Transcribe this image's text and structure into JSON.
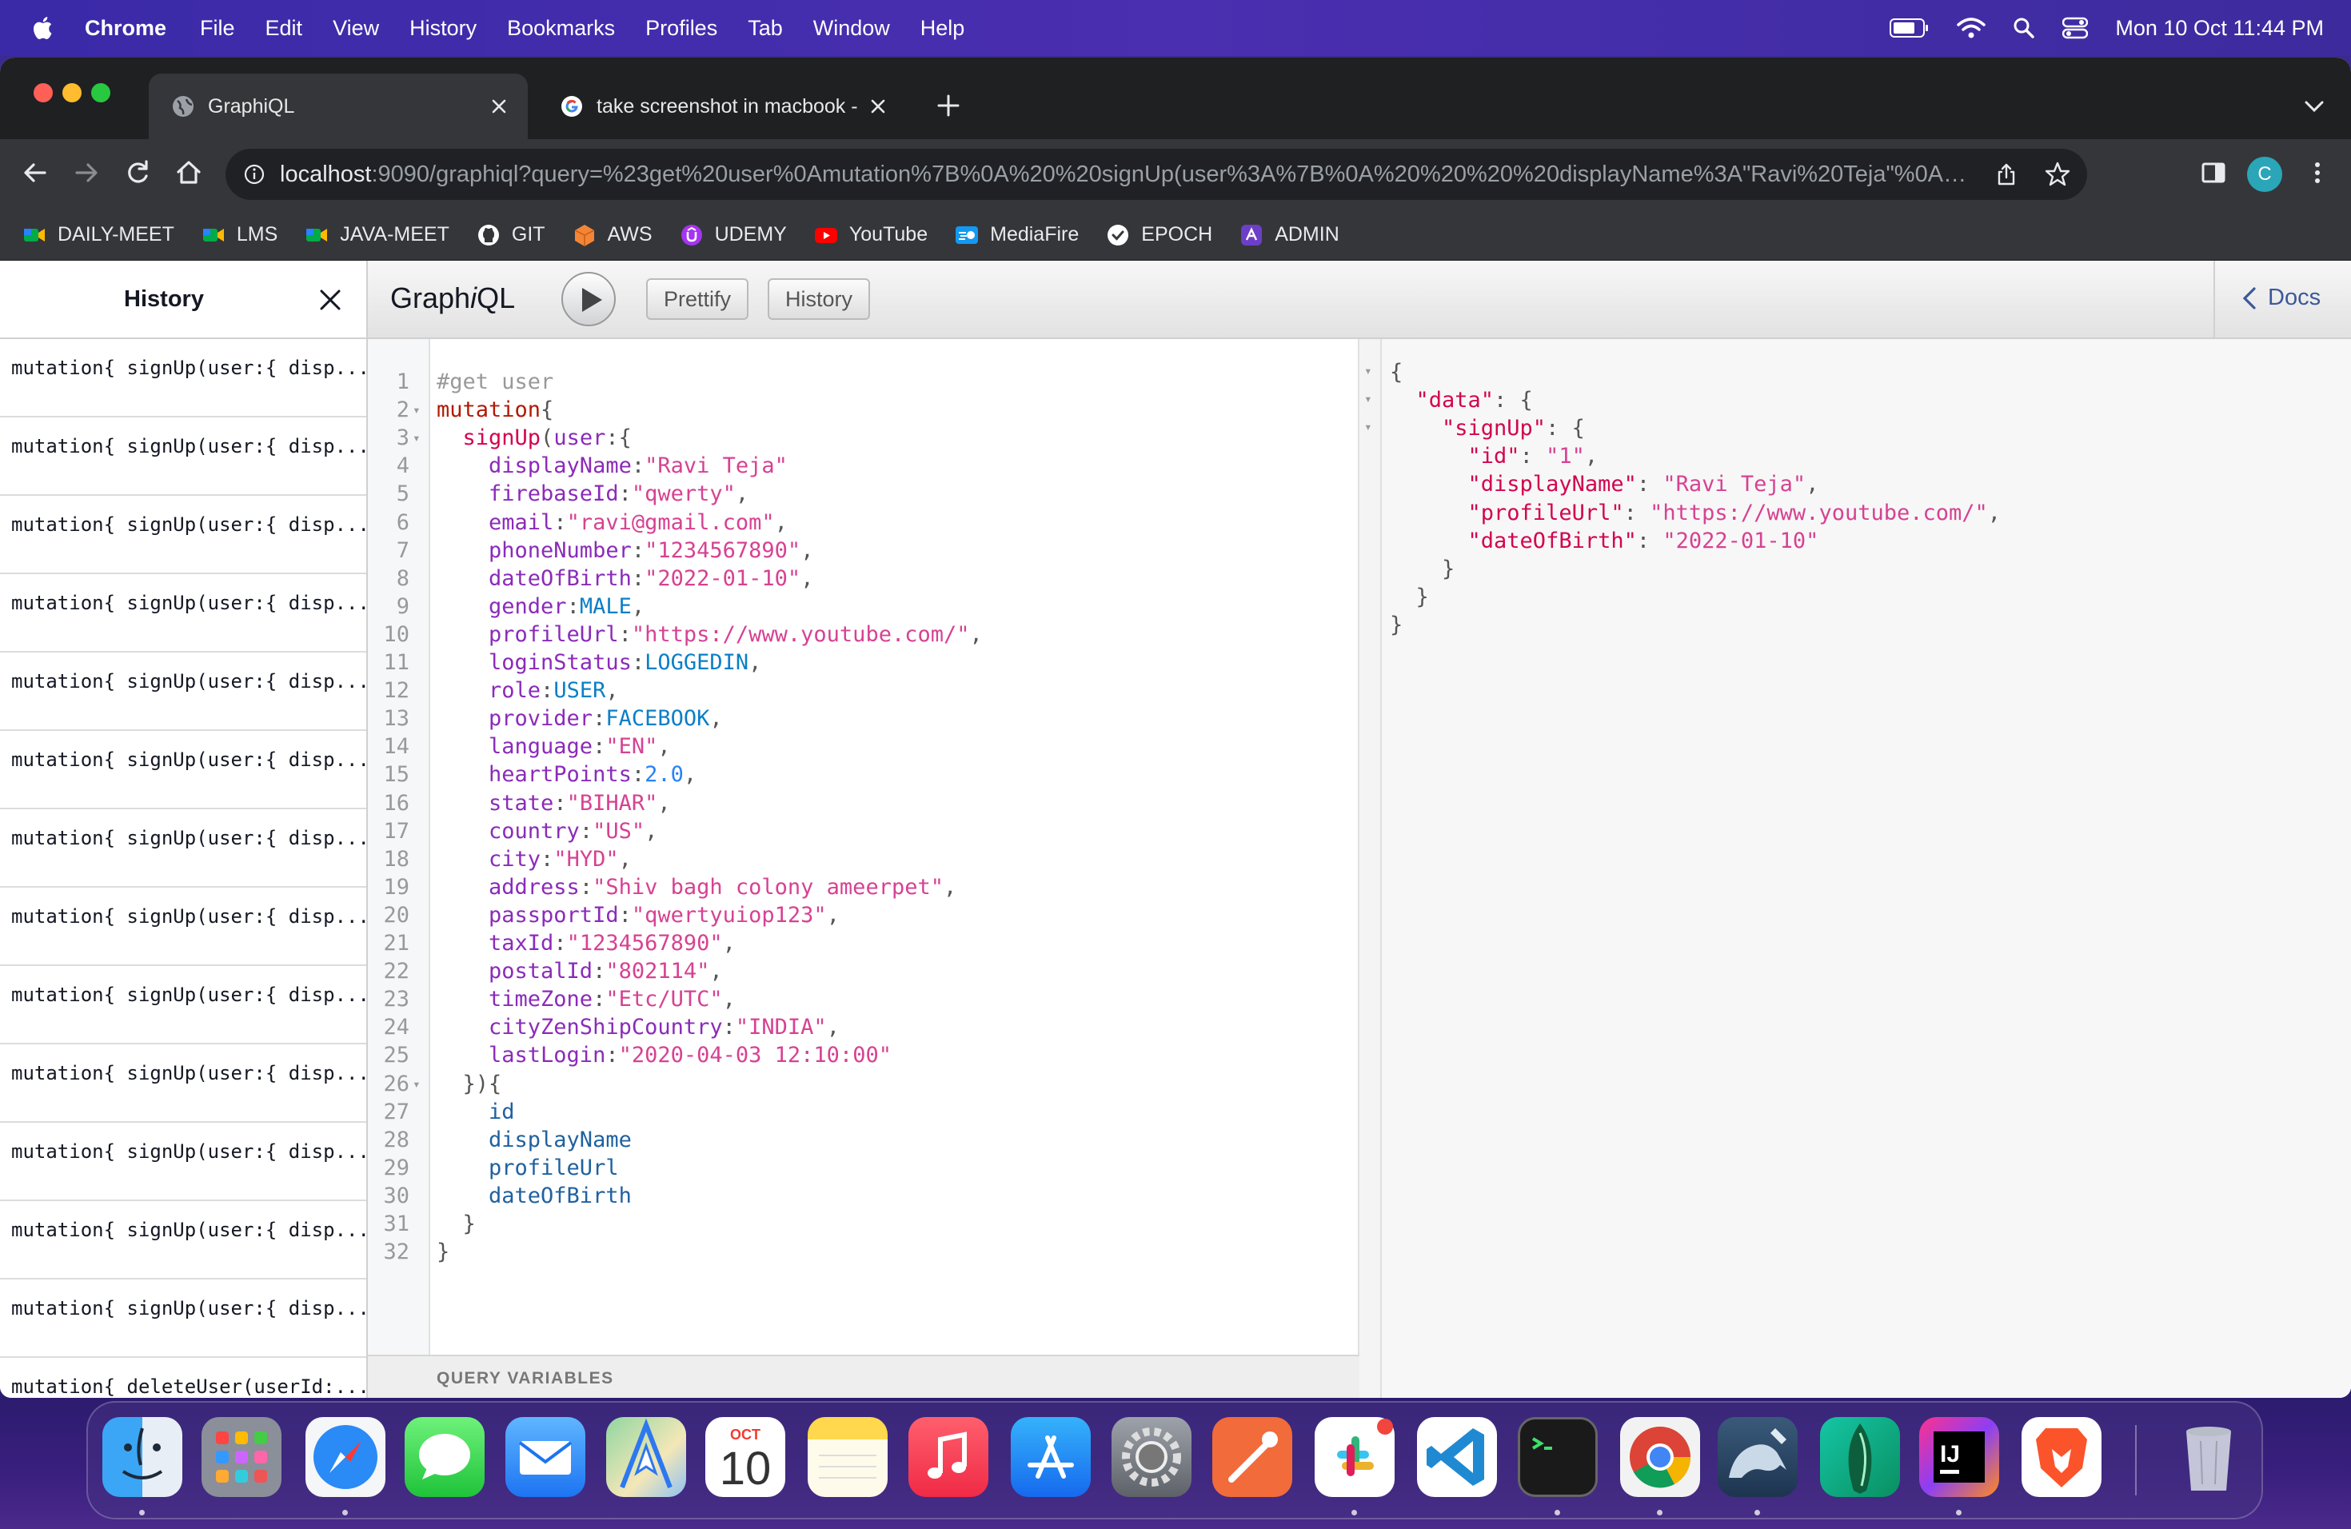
{
  "menubar": {
    "app": "Chrome",
    "menus": [
      "File",
      "Edit",
      "View",
      "History",
      "Bookmarks",
      "Profiles",
      "Tab",
      "Window",
      "Help"
    ],
    "clock": "Mon 10 Oct  11:44 PM"
  },
  "browser": {
    "tabs": [
      {
        "title": "GraphiQL",
        "active": true
      },
      {
        "title": "take screenshot in macbook - ",
        "active": false
      }
    ],
    "url_host": "localhost",
    "url_rest": ":9090/graphiql?query=%23get%20user%0Amutation%7B%0A%20%20signUp(user%3A%7B%0A%20%20%20%20displayName%3A\"Ravi%20Teja\"%0A%20...",
    "profile_initial": "C",
    "bookmarks": [
      "DAILY-MEET",
      "LMS",
      "JAVA-MEET",
      "GIT",
      "AWS",
      "UDEMY",
      "YouTube",
      "MediaFire",
      "EPOCH",
      "ADMIN"
    ]
  },
  "graphiql": {
    "title_prefix": "Graph",
    "title_italic": "i",
    "title_suffix": "QL",
    "prettify_label": "Prettify",
    "history_label": "History",
    "docs_label": "Docs",
    "query_variables_label": "QUERY VARIABLES",
    "history_panel": {
      "title": "History",
      "items": [
        "mutation{ signUp(user:{ disp...",
        "mutation{ signUp(user:{ disp...",
        "mutation{ signUp(user:{ disp...",
        "mutation{ signUp(user:{ disp...",
        "mutation{ signUp(user:{ disp...",
        "mutation{ signUp(user:{ disp...",
        "mutation{ signUp(user:{ disp...",
        "mutation{ signUp(user:{ disp...",
        "mutation{ signUp(user:{ disp...",
        "mutation{ signUp(user:{ disp...",
        "mutation{ signUp(user:{ disp...",
        "mutation{ signUp(user:{ disp...",
        "mutation{ signUp(user:{ disp...",
        "mutation{ deleteUser(userId:..."
      ]
    },
    "query_lines": [
      {
        "n": "1",
        "fold": "",
        "tokens": [
          [
            "c-comment",
            "#get user"
          ]
        ]
      },
      {
        "n": "2",
        "fold": "▾",
        "tokens": [
          [
            "c-keyword",
            "mutation"
          ],
          [
            "c-punc",
            "{"
          ]
        ]
      },
      {
        "n": "3",
        "fold": "▾",
        "tokens": [
          [
            "c-def",
            "  signUp"
          ],
          [
            "c-punc",
            "("
          ],
          [
            "c-attr",
            "user"
          ],
          [
            "c-punc",
            ":{"
          ]
        ]
      },
      {
        "n": "4",
        "fold": "",
        "tokens": [
          [
            "c-attr",
            "    displayName"
          ],
          [
            "c-punc",
            ":"
          ],
          [
            "c-string",
            "\"Ravi Teja\""
          ]
        ]
      },
      {
        "n": "5",
        "fold": "",
        "tokens": [
          [
            "c-attr",
            "    firebaseId"
          ],
          [
            "c-punc",
            ":"
          ],
          [
            "c-string",
            "\"qwerty\""
          ],
          [
            "c-punc",
            ","
          ]
        ]
      },
      {
        "n": "6",
        "fold": "",
        "tokens": [
          [
            "c-attr",
            "    email"
          ],
          [
            "c-punc",
            ":"
          ],
          [
            "c-string",
            "\"ravi@gmail.com\""
          ],
          [
            "c-punc",
            ","
          ]
        ]
      },
      {
        "n": "7",
        "fold": "",
        "tokens": [
          [
            "c-attr",
            "    phoneNumber"
          ],
          [
            "c-punc",
            ":"
          ],
          [
            "c-string",
            "\"1234567890\""
          ],
          [
            "c-punc",
            ","
          ]
        ]
      },
      {
        "n": "8",
        "fold": "",
        "tokens": [
          [
            "c-attr",
            "    dateOfBirth"
          ],
          [
            "c-punc",
            ":"
          ],
          [
            "c-string",
            "\"2022-01-10\""
          ],
          [
            "c-punc",
            ","
          ]
        ]
      },
      {
        "n": "9",
        "fold": "",
        "tokens": [
          [
            "c-attr",
            "    gender"
          ],
          [
            "c-punc",
            ":"
          ],
          [
            "c-enum",
            "MALE"
          ],
          [
            "c-punc",
            ","
          ]
        ]
      },
      {
        "n": "10",
        "fold": "",
        "tokens": [
          [
            "c-attr",
            "    profileUrl"
          ],
          [
            "c-punc",
            ":"
          ],
          [
            "c-string",
            "\"https://www.youtube.com/\""
          ],
          [
            "c-punc",
            ","
          ]
        ]
      },
      {
        "n": "11",
        "fold": "",
        "tokens": [
          [
            "c-attr",
            "    loginStatus"
          ],
          [
            "c-punc",
            ":"
          ],
          [
            "c-enum",
            "LOGGEDIN"
          ],
          [
            "c-punc",
            ","
          ]
        ]
      },
      {
        "n": "12",
        "fold": "",
        "tokens": [
          [
            "c-attr",
            "    role"
          ],
          [
            "c-punc",
            ":"
          ],
          [
            "c-enum",
            "USER"
          ],
          [
            "c-punc",
            ","
          ]
        ]
      },
      {
        "n": "13",
        "fold": "",
        "tokens": [
          [
            "c-attr",
            "    provider"
          ],
          [
            "c-punc",
            ":"
          ],
          [
            "c-enum",
            "FACEBOOK"
          ],
          [
            "c-punc",
            ","
          ]
        ]
      },
      {
        "n": "14",
        "fold": "",
        "tokens": [
          [
            "c-attr",
            "    language"
          ],
          [
            "c-punc",
            ":"
          ],
          [
            "c-string",
            "\"EN\""
          ],
          [
            "c-punc",
            ","
          ]
        ]
      },
      {
        "n": "15",
        "fold": "",
        "tokens": [
          [
            "c-attr",
            "    heartPoints"
          ],
          [
            "c-punc",
            ":"
          ],
          [
            "c-num",
            "2.0"
          ],
          [
            "c-punc",
            ","
          ]
        ]
      },
      {
        "n": "16",
        "fold": "",
        "tokens": [
          [
            "c-attr",
            "    state"
          ],
          [
            "c-punc",
            ":"
          ],
          [
            "c-string",
            "\"BIHAR\""
          ],
          [
            "c-punc",
            ","
          ]
        ]
      },
      {
        "n": "17",
        "fold": "",
        "tokens": [
          [
            "c-attr",
            "    country"
          ],
          [
            "c-punc",
            ":"
          ],
          [
            "c-string",
            "\"US\""
          ],
          [
            "c-punc",
            ","
          ]
        ]
      },
      {
        "n": "18",
        "fold": "",
        "tokens": [
          [
            "c-attr",
            "    city"
          ],
          [
            "c-punc",
            ":"
          ],
          [
            "c-string",
            "\"HYD\""
          ],
          [
            "c-punc",
            ","
          ]
        ]
      },
      {
        "n": "19",
        "fold": "",
        "tokens": [
          [
            "c-attr",
            "    address"
          ],
          [
            "c-punc",
            ":"
          ],
          [
            "c-string",
            "\"Shiv bagh colony ameerpet\""
          ],
          [
            "c-punc",
            ","
          ]
        ]
      },
      {
        "n": "20",
        "fold": "",
        "tokens": [
          [
            "c-attr",
            "    passportId"
          ],
          [
            "c-punc",
            ":"
          ],
          [
            "c-string",
            "\"qwertyuiop123\""
          ],
          [
            "c-punc",
            ","
          ]
        ]
      },
      {
        "n": "21",
        "fold": "",
        "tokens": [
          [
            "c-attr",
            "    taxId"
          ],
          [
            "c-punc",
            ":"
          ],
          [
            "c-string",
            "\"1234567890\""
          ],
          [
            "c-punc",
            ","
          ]
        ]
      },
      {
        "n": "22",
        "fold": "",
        "tokens": [
          [
            "c-attr",
            "    postalId"
          ],
          [
            "c-punc",
            ":"
          ],
          [
            "c-string",
            "\"802114\""
          ],
          [
            "c-punc",
            ","
          ]
        ]
      },
      {
        "n": "23",
        "fold": "",
        "tokens": [
          [
            "c-attr",
            "    timeZone"
          ],
          [
            "c-punc",
            ":"
          ],
          [
            "c-string",
            "\"Etc/UTC\""
          ],
          [
            "c-punc",
            ","
          ]
        ]
      },
      {
        "n": "24",
        "fold": "",
        "tokens": [
          [
            "c-attr",
            "    cityZenShipCountry"
          ],
          [
            "c-punc",
            ":"
          ],
          [
            "c-string",
            "\"INDIA\""
          ],
          [
            "c-punc",
            ","
          ]
        ]
      },
      {
        "n": "25",
        "fold": "",
        "tokens": [
          [
            "c-attr",
            "    lastLogin"
          ],
          [
            "c-punc",
            ":"
          ],
          [
            "c-string",
            "\"2020-04-03 12:10:00\""
          ]
        ]
      },
      {
        "n": "26",
        "fold": "▾",
        "tokens": [
          [
            "c-punc",
            "  }){"
          ]
        ]
      },
      {
        "n": "27",
        "fold": "",
        "tokens": [
          [
            "c-prop",
            "    id"
          ]
        ]
      },
      {
        "n": "28",
        "fold": "",
        "tokens": [
          [
            "c-prop",
            "    displayName"
          ]
        ]
      },
      {
        "n": "29",
        "fold": "",
        "tokens": [
          [
            "c-prop",
            "    profileUrl"
          ]
        ]
      },
      {
        "n": "30",
        "fold": "",
        "tokens": [
          [
            "c-prop",
            "    dateOfBirth"
          ]
        ]
      },
      {
        "n": "31",
        "fold": "",
        "tokens": [
          [
            "c-punc",
            "  }"
          ]
        ]
      },
      {
        "n": "32",
        "fold": "",
        "tokens": [
          [
            "c-punc",
            "}"
          ]
        ]
      }
    ],
    "result_lines": [
      {
        "fold": "▾",
        "tokens": [
          [
            "c-punc",
            "{"
          ]
        ]
      },
      {
        "fold": "▾",
        "tokens": [
          [
            "c-def",
            "  \"data\""
          ],
          [
            "c-punc",
            ": {"
          ]
        ]
      },
      {
        "fold": "▾",
        "tokens": [
          [
            "c-def",
            "    \"signUp\""
          ],
          [
            "c-punc",
            ": {"
          ]
        ]
      },
      {
        "fold": "",
        "tokens": [
          [
            "c-def",
            "      \"id\""
          ],
          [
            "c-punc",
            ": "
          ],
          [
            "c-string",
            "\"1\""
          ],
          [
            "c-punc",
            ","
          ]
        ]
      },
      {
        "fold": "",
        "tokens": [
          [
            "c-def",
            "      \"displayName\""
          ],
          [
            "c-punc",
            ": "
          ],
          [
            "c-string",
            "\"Ravi Teja\""
          ],
          [
            "c-punc",
            ","
          ]
        ]
      },
      {
        "fold": "",
        "tokens": [
          [
            "c-def",
            "      \"profileUrl\""
          ],
          [
            "c-punc",
            ": "
          ],
          [
            "c-string",
            "\"https://www.youtube.com/\""
          ],
          [
            "c-punc",
            ","
          ]
        ]
      },
      {
        "fold": "",
        "tokens": [
          [
            "c-def",
            "      \"dateOfBirth\""
          ],
          [
            "c-punc",
            ": "
          ],
          [
            "c-string",
            "\"2022-01-10\""
          ]
        ]
      },
      {
        "fold": "",
        "tokens": [
          [
            "c-punc",
            "    }"
          ]
        ]
      },
      {
        "fold": "",
        "tokens": [
          [
            "c-punc",
            "  }"
          ]
        ]
      },
      {
        "fold": "",
        "tokens": [
          [
            "c-punc",
            "}"
          ]
        ]
      }
    ]
  },
  "dock": {
    "apps": [
      "finder-icon",
      "launchpad-icon",
      "safari-icon",
      "messages-icon",
      "mail-icon",
      "maps-icon",
      "calendar-icon",
      "notes-icon",
      "music-icon",
      "app-store-icon",
      "system-preferences-icon",
      "postman-icon",
      "slack-icon",
      "vscode-icon",
      "terminal-icon",
      "chrome-icon",
      "mysql-workbench-icon",
      "mongodb-compass-icon",
      "intellij-icon",
      "brave-icon"
    ],
    "calendar_month": "OCT",
    "calendar_day": "10",
    "intellij_label": "IJ"
  }
}
